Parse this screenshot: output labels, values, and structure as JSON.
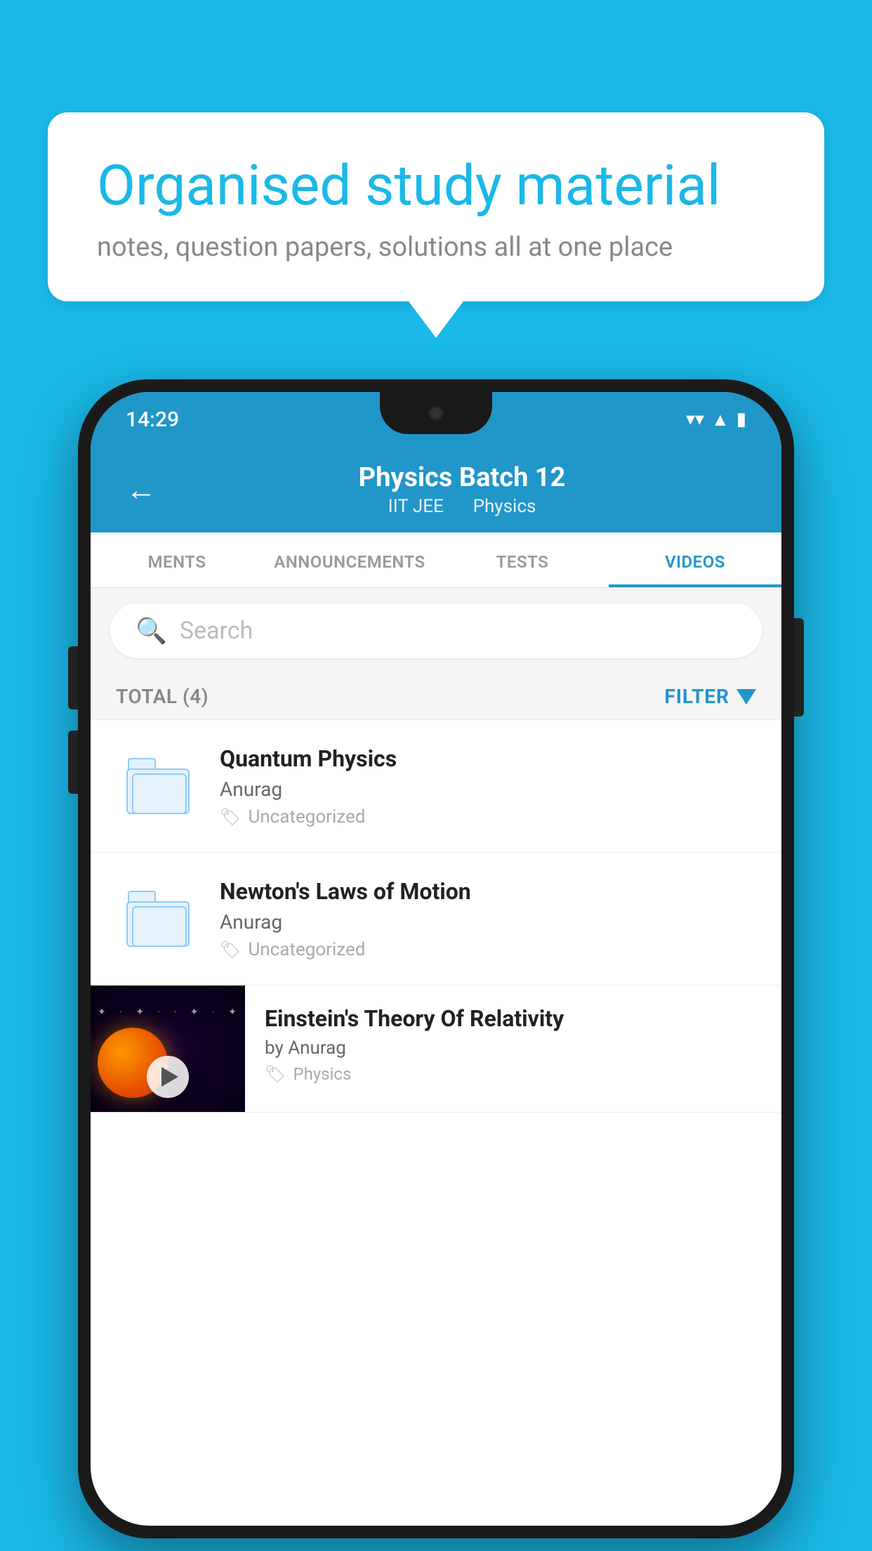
{
  "background_color": "#1ab8e8",
  "speech_bubble": {
    "heading": "Organised study material",
    "subtext": "notes, question papers, solutions all at one place"
  },
  "phone": {
    "status_bar": {
      "time": "14:29",
      "icons": [
        "wifi",
        "signal",
        "battery"
      ]
    },
    "header": {
      "back_label": "←",
      "title": "Physics Batch 12",
      "subtitle_part1": "IIT JEE",
      "subtitle_part2": "Physics"
    },
    "tabs": [
      {
        "label": "MENTS",
        "active": false
      },
      {
        "label": "ANNOUNCEMENTS",
        "active": false
      },
      {
        "label": "TESTS",
        "active": false
      },
      {
        "label": "VIDEOS",
        "active": true
      }
    ],
    "search": {
      "placeholder": "Search"
    },
    "filter_row": {
      "total_label": "TOTAL (4)",
      "filter_label": "FILTER"
    },
    "videos": [
      {
        "id": "quantum",
        "title": "Quantum Physics",
        "author": "Anurag",
        "tag": "Uncategorized",
        "type": "folder"
      },
      {
        "id": "newton",
        "title": "Newton's Laws of Motion",
        "author": "Anurag",
        "tag": "Uncategorized",
        "type": "folder"
      },
      {
        "id": "einstein",
        "title": "Einstein's Theory Of Relativity",
        "author": "by Anurag",
        "tag": "Physics",
        "type": "video"
      }
    ]
  }
}
